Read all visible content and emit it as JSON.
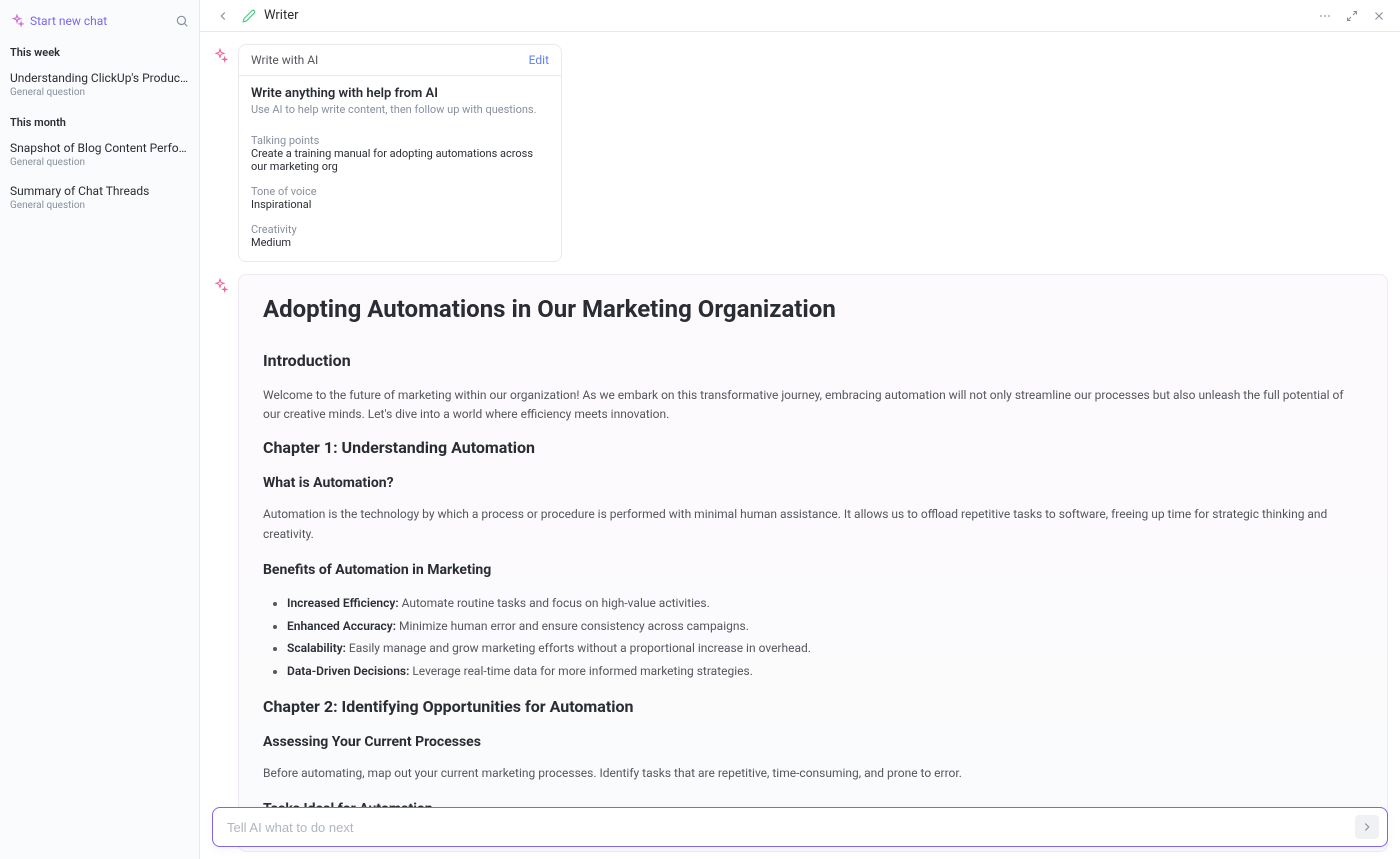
{
  "sidebar": {
    "new_chat_label": "Start new chat",
    "sections": [
      {
        "label": "This week",
        "items": [
          {
            "title": "Understanding ClickUp's Product-Le…",
            "subtitle": "General question"
          }
        ]
      },
      {
        "label": "This month",
        "items": [
          {
            "title": "Snapshot of Blog Content Performan…",
            "subtitle": "General question"
          },
          {
            "title": "Summary of Chat Threads",
            "subtitle": "General question"
          }
        ]
      }
    ]
  },
  "header": {
    "title": "Writer"
  },
  "prompt_card": {
    "header_title": "Write with AI",
    "edit_label": "Edit",
    "main_title": "Write anything with help from AI",
    "description": "Use AI to help write content, then follow up with questions.",
    "fields": [
      {
        "label": "Talking points",
        "value": "Create a training manual for adopting automations across our marketing org"
      },
      {
        "label": "Tone of voice",
        "value": "Inspirational"
      },
      {
        "label": "Creativity",
        "value": "Medium"
      }
    ]
  },
  "output": {
    "title": "Adopting Automations in Our Marketing Organization",
    "intro_heading": "Introduction",
    "intro_text": "Welcome to the future of marketing within our organization! As we embark on this transformative journey, embracing automation will not only streamline our processes but also unleash the full potential of our creative minds. Let's dive into a world where efficiency meets innovation.",
    "ch1_heading": "Chapter 1: Understanding Automation",
    "ch1_sub1": "What is Automation?",
    "ch1_sub1_text": "Automation is the technology by which a process or procedure is performed with minimal human assistance. It allows us to offload repetitive tasks to software, freeing up time for strategic thinking and creativity.",
    "ch1_sub2": "Benefits of Automation in Marketing",
    "benefits": [
      {
        "bold": "Increased Efficiency:",
        "text": " Automate routine tasks and focus on high-value activities."
      },
      {
        "bold": "Enhanced Accuracy:",
        "text": " Minimize human error and ensure consistency across campaigns."
      },
      {
        "bold": "Scalability:",
        "text": " Easily manage and grow marketing efforts without a proportional increase in overhead."
      },
      {
        "bold": "Data-Driven Decisions:",
        "text": " Leverage real-time data for more informed marketing strategies."
      }
    ],
    "ch2_heading": "Chapter 2: Identifying Opportunities for Automation",
    "ch2_sub1": "Assessing Your Current Processes",
    "ch2_sub1_text": "Before automating, map out your current marketing processes. Identify tasks that are repetitive, time-consuming, and prone to error.",
    "ch2_sub2": "Tasks Ideal for Automation"
  },
  "input": {
    "placeholder": "Tell AI what to do next"
  }
}
